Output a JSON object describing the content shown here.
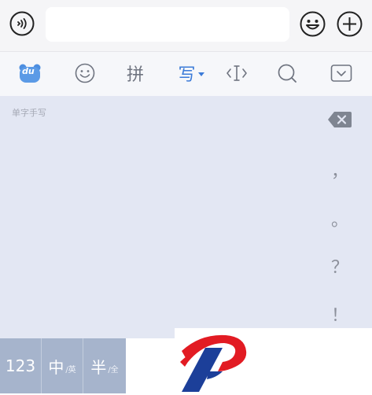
{
  "input_bar": {
    "text_value": "",
    "placeholder": ""
  },
  "toolbar": {
    "logo_text": "du",
    "pinyin_label": "拼",
    "write_label": "写"
  },
  "handwriting": {
    "hint": "单字手写"
  },
  "punctuation": {
    "comma": "，",
    "period": "。",
    "question": "？",
    "exclaim": "！"
  },
  "keys": {
    "numbers": "123",
    "chinese": "中",
    "english": "/英",
    "half": "半",
    "full": "/全"
  },
  "colors": {
    "accent": "#3c7bd8",
    "pad_background": "#e3e7f3",
    "bottom_key_background": "#a6b4cc",
    "logo_red": "#e21b23",
    "logo_blue": "#1c3f99"
  },
  "icons": [
    "voice-icon",
    "smiley-icon",
    "plus-icon",
    "bear-logo-icon",
    "emoji-icon",
    "cursor-icon",
    "search-icon",
    "hide-keyboard-icon",
    "backspace-icon",
    "brand-logo"
  ]
}
